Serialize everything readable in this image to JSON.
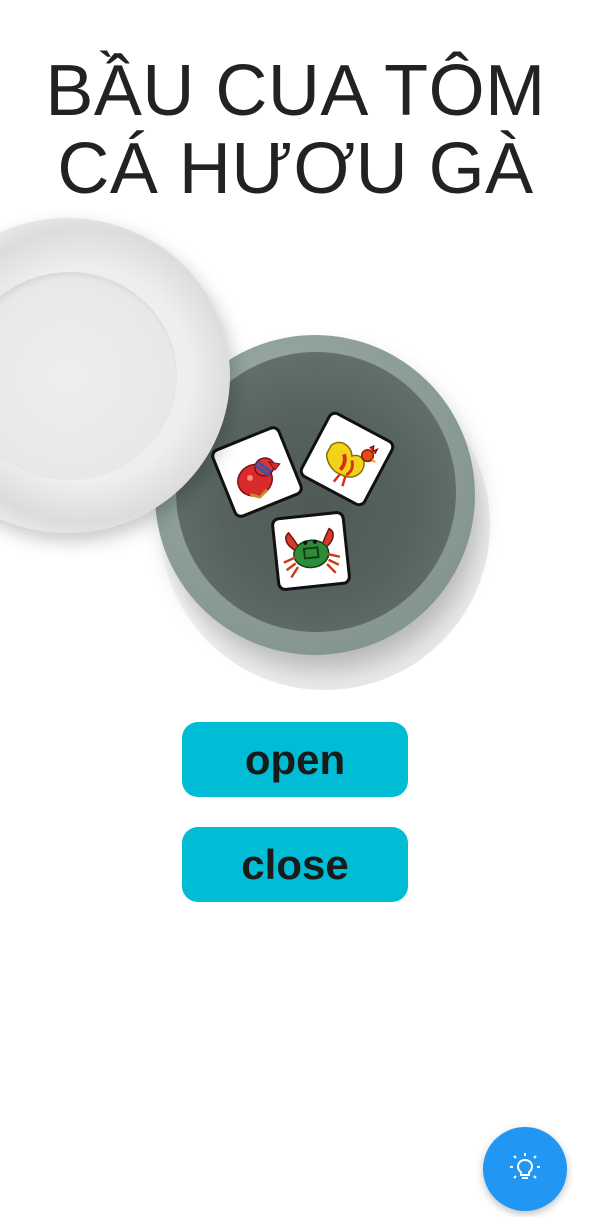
{
  "title": {
    "line1": "BẦU CUA TÔM",
    "line2": "CÁ HƯƠU GÀ"
  },
  "dice": [
    {
      "name": "gourd-die",
      "icon": "gourd-icon"
    },
    {
      "name": "rooster-die",
      "icon": "rooster-icon"
    },
    {
      "name": "crab-die",
      "icon": "crab-icon"
    }
  ],
  "buttons": {
    "open_label": "open",
    "close_label": "close"
  },
  "fab": {
    "icon": "lightbulb-icon"
  },
  "colors": {
    "button": "#00bcd4",
    "fab": "#2196f3",
    "bowl": "#8a9c95"
  }
}
